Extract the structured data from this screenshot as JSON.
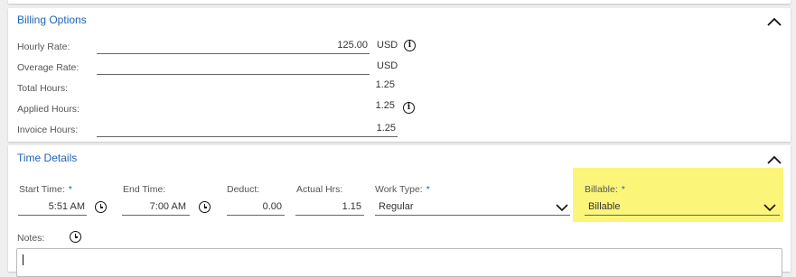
{
  "billing": {
    "title": "Billing Options",
    "hourly_rate_label": "Hourly Rate:",
    "hourly_rate_value": "125.00",
    "hourly_rate_currency": "USD",
    "overage_rate_label": "Overage Rate:",
    "overage_rate_value": "",
    "overage_rate_currency": "USD",
    "total_hours_label": "Total Hours:",
    "total_hours_value": "1.25",
    "applied_hours_label": "Applied Hours:",
    "applied_hours_value": "1.25",
    "invoice_hours_label": "Invoice Hours:",
    "invoice_hours_value": "1.25"
  },
  "time": {
    "title": "Time Details",
    "start_time_label": "Start Time:",
    "start_time_value": "5:51 AM",
    "end_time_label": "End Time:",
    "end_time_value": "7:00 AM",
    "deduct_label": "Deduct:",
    "deduct_value": "0.00",
    "actual_hrs_label": "Actual Hrs:",
    "actual_hrs_value": "1.15",
    "work_type_label": "Work Type:",
    "work_type_value": "Regular",
    "billable_label": "Billable:",
    "billable_value": "Billable",
    "notes_label": "Notes:",
    "notes_value": "",
    "required_marker": "*"
  },
  "colors": {
    "accent": "#1e64b4",
    "highlight": "#fbf57a"
  },
  "icons": [
    "chevron-up-icon",
    "info-icon",
    "clock-icon",
    "chevron-down-icon"
  ]
}
